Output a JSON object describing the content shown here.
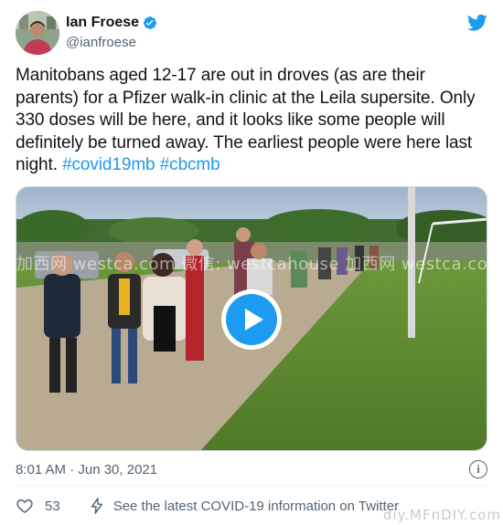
{
  "author": {
    "name": "Ian Froese",
    "handle": "@ianfroese",
    "avatar_icon": "avatar-photo",
    "verified_icon": "verified-badge-icon"
  },
  "brand": {
    "icon": "twitter-bird-icon",
    "color": "#1d9bf0"
  },
  "tweet": {
    "text_main": "Manitobans aged 12-17 are out in droves (as are their parents) for a Pfizer walk-in clinic at the Leila supersite. Only 330 doses will be here, and it looks like some people will definitely be turned away. The earliest people were here last night. ",
    "hashtag_1": "#covid19mb",
    "hashtag_2": "#cbcmb",
    "link_color": "#1d9bf0"
  },
  "media": {
    "type": "video",
    "play_icon": "play-icon",
    "watermark_text": "加西网 westca.com  微信: westcahouse  加西网 westca.com  微信: westcahouse"
  },
  "meta": {
    "timestamp": "8:01 AM · Jun 30, 2021",
    "info_icon": "info-icon"
  },
  "actions": {
    "like_count": "53",
    "like_icon": "heart-icon",
    "covid_icon": "lightning-icon",
    "covid_text": "See the latest COVID-19 information on Twitter"
  },
  "footer_watermark": "diy.MFnDIY.com"
}
